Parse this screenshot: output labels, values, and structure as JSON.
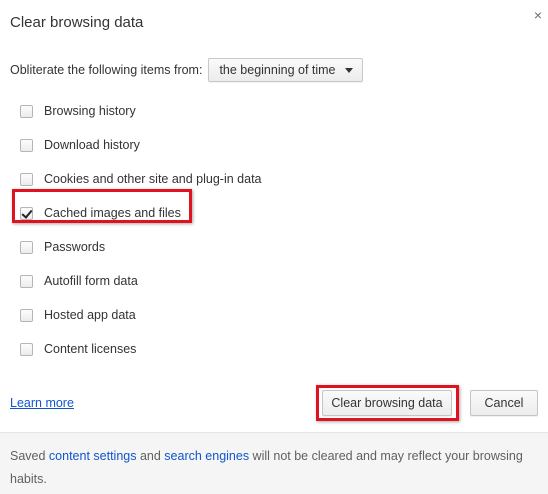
{
  "dialog": {
    "title": "Clear browsing data",
    "close_glyph": "×"
  },
  "time_range": {
    "label": "Obliterate the following items from:",
    "selected": "the beginning of time"
  },
  "options": [
    {
      "label": "Browsing history",
      "checked": false
    },
    {
      "label": "Download history",
      "checked": false
    },
    {
      "label": "Cookies and other site and plug-in data",
      "checked": false
    },
    {
      "label": "Cached images and files",
      "checked": true
    },
    {
      "label": "Passwords",
      "checked": false
    },
    {
      "label": "Autofill form data",
      "checked": false
    },
    {
      "label": "Hosted app data",
      "checked": false
    },
    {
      "label": "Content licenses",
      "checked": false
    }
  ],
  "actions": {
    "learn_more": "Learn more",
    "clear_label": "Clear browsing data",
    "cancel_label": "Cancel"
  },
  "footer": {
    "prefix": "Saved ",
    "link1": "content settings",
    "middle": " and ",
    "link2": "search engines",
    "suffix": " will not be cleared and may reflect your browsing habits."
  },
  "colors": {
    "highlight": "#e0121d",
    "link": "#1155cc"
  }
}
